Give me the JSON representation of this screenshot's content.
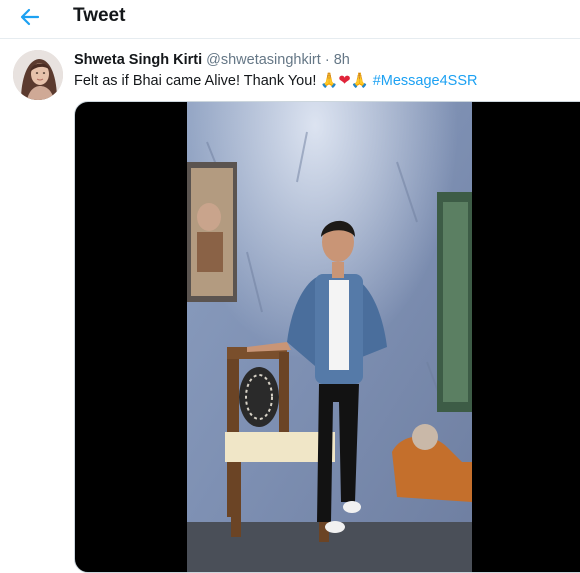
{
  "header": {
    "title": "Tweet",
    "back_icon": "arrow-left-icon",
    "accent_color": "#1da1f2"
  },
  "tweet": {
    "author_name": "Shweta Singh Kirti",
    "author_handle": "@shwetasinghkirt",
    "separator": "·",
    "time": "8h",
    "text_start": "Felt as if Bhai came Alive! Thank You!",
    "emoji_pray": "🙏",
    "emoji_heart": "❤",
    "hashtag": "#Message4SSR",
    "media_type": "video"
  }
}
